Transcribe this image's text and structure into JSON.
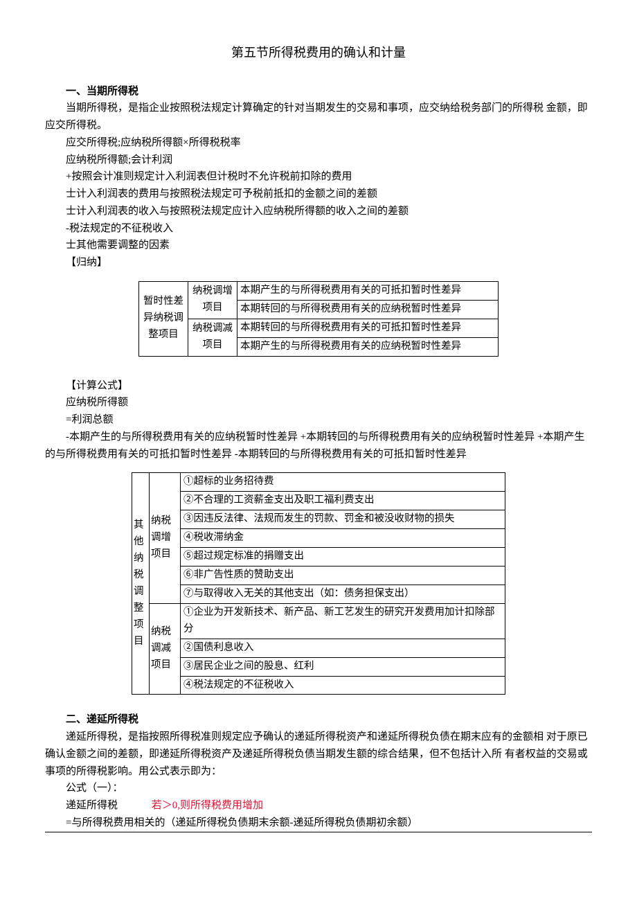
{
  "title": "第五节所得税费用的确认和计量",
  "s1": {
    "h": "一、当期所得税",
    "p1": "当期所得税，是指企业按照税法规定计算确定的针对当期发生的交易和事项，应交纳给税务部门的所得税 金额，即应交所得税。",
    "l1": "应交所得税;应纳税所得额×所得税税率",
    "l2": "应纳税所得额;会计利润",
    "l3": "+按照会计准则规定计入利润表但计税时不允许税前扣除的费用",
    "l4": "士计入利润表的费用与按照税法规定可予税前抵扣的金额之间的差额",
    "l5": "士计入利润表的收入与按照税法规定应计入应纳税所得额的收入之间的差额",
    "l6": "-税法规定的不征税收入",
    "l7": "士其他需要调整的因素",
    "l8": "【归纳】"
  },
  "table1": {
    "r1c1": "暂时性差异纳税调整项目",
    "r1c2": "纳税调增项目",
    "r1c3": "本期产生的与所得税费用有关的可抵扣暂时性差异",
    "r2c3": "本期转回的与所得税费用有关的应纳税暂时性差异",
    "r3c2": "纳税调减项目",
    "r3c3": "本期转回的与所得税费用有关的可抵扣暂时性差异",
    "r4c3": "本期产生的与所得税费用有关的应纳税暂时性差异"
  },
  "calc": {
    "h": "【计算公式】",
    "l1": "应纳税所得额",
    "l2": "=利润总额",
    "l3": "-本期产生的与所得税费用有关的应纳税暂时性差异 +本期转回的与所得税费用有关的应纳税暂时性差异 +本期产生的与所得税费用有关的可抵扣暂时性差异 -本期转回的与所得税费用有关的可抵扣暂时性差异"
  },
  "table2": {
    "c1": "其他纳税调整项目",
    "g1": "纳税调增项目",
    "g1r1": "①超标的业务招待费",
    "g1r2": "②不合理的工资薪金支出及职工福利费支出",
    "g1r3": "③因违反法律、法规而发生的罚款、罚金和被没收财物的损失",
    "g1r4": "④税收滞纳金",
    "g1r5": "⑤超过规定标准的捐赠支出",
    "g1r6": "⑥非广告性质的赞助支出",
    "g1r7": "⑦与取得收入无关的其他支出（如：债务担保支出）",
    "g2": "纳税调减项目",
    "g2r1": "①企业为开发新技术、新产品、新工艺发生的研究开发费用加计扣除部分",
    "g2r2": "②国债利息收入",
    "g2r3": "③居民企业之间的股息、红利",
    "g2r4": "④税法规定的不征税收入"
  },
  "s2": {
    "h": "二、递延所得税",
    "p1": "递延所得税，是指按照所得税准则规定应予确认的递延所得税资产和递延所得税负债在期末应有的金额相 对于原已确认金额之间的差额，即递延所得税资产及递延所得税负债当期发生额的综合结果，但不包括计入所 有者权益的交易或事项的所得税影响。用公式表示即为：",
    "l1": "公式（一）：",
    "l2a": "递延所得税",
    "l2b": "若＞0,则所得税费用增加",
    "l3": "=与所得税费用相关的（递延所得税负债期末余额-递延所得税负债期初余额）"
  }
}
